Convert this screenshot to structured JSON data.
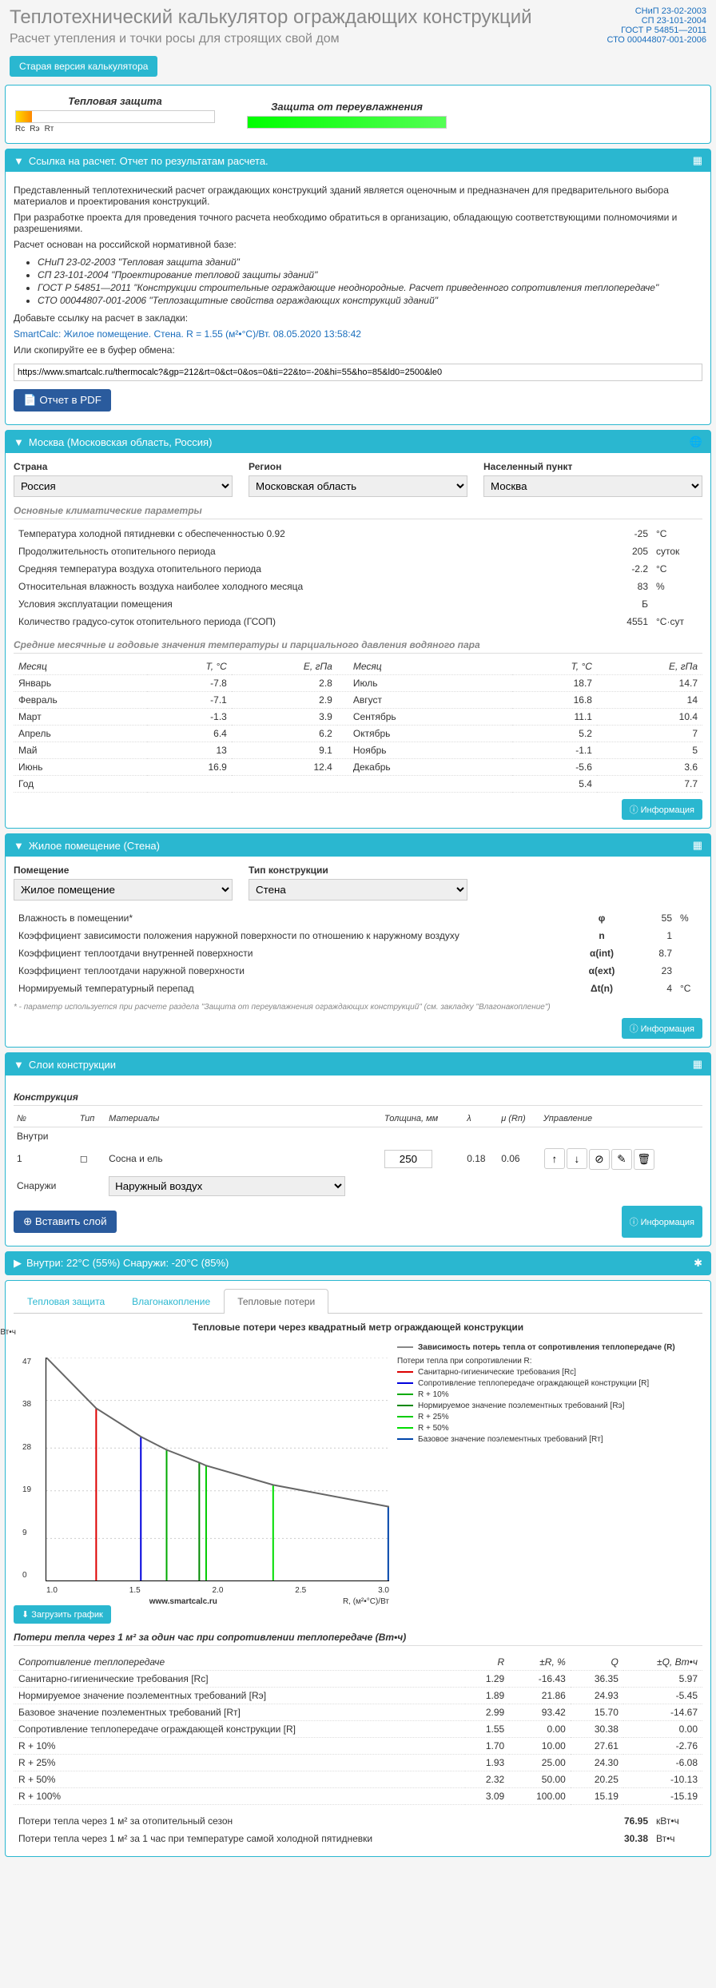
{
  "header": {
    "title": "Теплотехнический калькулятор ограждающих конструкций",
    "subtitle": "Расчет утепления и точки росы для строящих свой дом",
    "norms": [
      "СНиП 23-02-2003",
      "СП 23-101-2004",
      "ГОСТ Р 54851—2011",
      "СТО 00044807-001-2006"
    ],
    "old_version_btn": "Старая версия калькулятора"
  },
  "indicators": {
    "thermal_label": "Тепловая защита",
    "moisture_label": "Защита от переувлажнения",
    "marks": [
      "Rс",
      "Rэ",
      "Rт"
    ]
  },
  "report_panel": {
    "title": "Ссылка на расчет. Отчет по результатам расчета.",
    "p1": "Представленный теплотехнический расчет ограждающих конструкций зданий является оценочным и предназначен для предварительного выбора материалов и проектирования конструкций.",
    "p2": "При разработке проекта для проведения точного расчета необходимо обратиться в организацию, обладающую соответствующими полномочиями и разрешениями.",
    "p3": "Расчет основан на российской нормативной базе:",
    "norms": [
      "СНиП 23-02-2003 \"Тепловая защита зданий\"",
      "СП 23-101-2004 \"Проектирование тепловой защиты зданий\"",
      "ГОСТ Р 54851—2011 \"Конструкции строительные ограждающие неоднородные. Расчет приведенного сопротивления теплопередаче\"",
      "СТО 00044807-001-2006 \"Теплозащитные свойства ограждающих конструкций зданий\""
    ],
    "bookmark_text": "Добавьте ссылку на расчет в закладки:",
    "bookmark_link": "SmartCalc: Жилое помещение. Стена. R = 1.55 (м²•°С)/Вт. 08.05.2020 13:58:42",
    "copy_text": "Или скопируйте ее в буфер обмена:",
    "url": "https://www.smartcalc.ru/thermocalc?&gp=212&rt=0&ct=0&os=0&ti=22&to=-20&hi=55&ho=85&ld0=2500&le0",
    "pdf_btn": "Отчет в PDF"
  },
  "location_panel": {
    "title": "Москва (Московская область, Россия)",
    "country_label": "Страна",
    "country_value": "Россия",
    "region_label": "Регион",
    "region_value": "Московская область",
    "city_label": "Населенный пункт",
    "city_value": "Москва",
    "climate_title": "Основные климатические параметры",
    "params": [
      {
        "name": "Температура холодной пятидневки с обеспеченностью 0.92",
        "val": "-25",
        "unit": "°С"
      },
      {
        "name": "Продолжительность отопительного периода",
        "val": "205",
        "unit": "суток"
      },
      {
        "name": "Средняя температура воздуха отопительного периода",
        "val": "-2.2",
        "unit": "°С"
      },
      {
        "name": "Относительная влажность воздуха наиболее холодного месяца",
        "val": "83",
        "unit": "%"
      },
      {
        "name": "Условия эксплуатации помещения",
        "val": "Б",
        "unit": ""
      },
      {
        "name": "Количество градусо-суток отопительного периода (ГСОП)",
        "val": "4551",
        "unit": "°С·сут"
      }
    ],
    "monthly_title": "Средние месячные и годовые значения температуры и парциального давления водяного пара",
    "month_hdr": "Месяц",
    "t_hdr": "T, °С",
    "e_hdr": "E, гПа",
    "months_left": [
      [
        "Январь",
        "-7.8",
        "2.8"
      ],
      [
        "Февраль",
        "-7.1",
        "2.9"
      ],
      [
        "Март",
        "-1.3",
        "3.9"
      ],
      [
        "Апрель",
        "6.4",
        "6.2"
      ],
      [
        "Май",
        "13",
        "9.1"
      ],
      [
        "Июнь",
        "16.9",
        "12.4"
      ]
    ],
    "months_right": [
      [
        "Июль",
        "18.7",
        "14.7"
      ],
      [
        "Август",
        "16.8",
        "14"
      ],
      [
        "Сентябрь",
        "11.1",
        "10.4"
      ],
      [
        "Октябрь",
        "5.2",
        "7"
      ],
      [
        "Ноябрь",
        "-1.1",
        "5"
      ],
      [
        "Декабрь",
        "-5.6",
        "3.6"
      ]
    ],
    "year_label": "Год",
    "year_t": "5.4",
    "year_e": "7.7",
    "info_btn": "Информация"
  },
  "room_panel": {
    "title": "Жилое помещение (Стена)",
    "room_label": "Помещение",
    "room_value": "Жилое помещение",
    "type_label": "Тип конструкции",
    "type_value": "Стена",
    "params": [
      {
        "name": "Влажность в помещении*",
        "sym": "φ",
        "val": "55",
        "unit": "%"
      },
      {
        "name": "Коэффициент зависимости положения наружной поверхности по отношению к наружному воздуху",
        "sym": "n",
        "val": "1",
        "unit": ""
      },
      {
        "name": "Коэффициент теплоотдачи внутренней поверхности",
        "sym": "α(int)",
        "val": "8.7",
        "unit": ""
      },
      {
        "name": "Коэффициент теплоотдачи наружной поверхности",
        "sym": "α(ext)",
        "val": "23",
        "unit": ""
      },
      {
        "name": "Нормируемый температурный перепад",
        "sym": "Δt(n)",
        "val": "4",
        "unit": "°С"
      }
    ],
    "footnote": "* - параметр используется при расчете раздела \"Защита от переувлажнения ограждающих конструкций\" (см. закладку \"Влагонакопление\")"
  },
  "layers_panel": {
    "title": "Слои конструкции",
    "construction_label": "Конструкция",
    "hdr": [
      "№",
      "Тип",
      "Материалы",
      "Толщина, мм",
      "λ",
      "μ (Rп)",
      "Управление"
    ],
    "inside_label": "Внутри",
    "outside_label": "Снаружи",
    "row": {
      "num": "1",
      "material": "Сосна и ель",
      "thickness": "250",
      "lambda": "0.18",
      "mu": "0.06"
    },
    "outside_value": "Наружный воздух",
    "insert_btn": "Вставить слой"
  },
  "conditions_panel": {
    "title": "Внутри: 22°С (55%) Снаружи: -20°С (85%)"
  },
  "heatloss_panel": {
    "tabs": [
      "Тепловая защита",
      "Влагонакопление",
      "Тепловые потери"
    ],
    "chart_title": "Тепловые потери через квадратный метр ограждающей конструкции",
    "y_label": "Q, Вт•ч",
    "x_label": "R, (м²•°С)/Вт",
    "legend_main": "Зависимость потерь тепла от сопротивления теплопередаче (R)",
    "legend_sub": "Потери тепла при сопротивлении R:",
    "legend": [
      {
        "c": "#d00",
        "t": "Санитарно-гигиенические требования [Rс]"
      },
      {
        "c": "#00d",
        "t": "Сопротивление теплопередаче ограждающей конструкции [R]"
      },
      {
        "c": "#0a0",
        "t": "R + 10%"
      },
      {
        "c": "#080",
        "t": "Нормируемое значение поэлементных требований [Rэ]"
      },
      {
        "c": "#0c0",
        "t": "R + 25%"
      },
      {
        "c": "#0d0",
        "t": "R + 50%"
      },
      {
        "c": "#04a",
        "t": "Базовое значение поэлементных требований [Rт]"
      }
    ],
    "watermark": "www.smartcalc.ru",
    "download_btn": "Загрузить график",
    "results_title": "Потери тепла через 1 м² за один час при сопротивлении теплопередаче (Вт•ч)",
    "results_hdr": [
      "Сопротивление теплопередаче",
      "R",
      "±R, %",
      "Q",
      "±Q, Вт•ч"
    ],
    "results": [
      [
        "Санитарно-гигиенические требования [Rс]",
        "1.29",
        "-16.43",
        "36.35",
        "5.97"
      ],
      [
        "Нормируемое значение поэлементных требований [Rэ]",
        "1.89",
        "21.86",
        "24.93",
        "-5.45"
      ],
      [
        "Базовое значение поэлементных требований [Rт]",
        "2.99",
        "93.42",
        "15.70",
        "-14.67"
      ],
      [
        "Сопротивление теплопередаче ограждающей конструкции [R]",
        "1.55",
        "0.00",
        "30.38",
        "0.00"
      ],
      [
        "R + 10%",
        "1.70",
        "10.00",
        "27.61",
        "-2.76"
      ],
      [
        "R + 25%",
        "1.93",
        "25.00",
        "24.30",
        "-6.08"
      ],
      [
        "R + 50%",
        "2.32",
        "50.00",
        "20.25",
        "-10.13"
      ],
      [
        "R + 100%",
        "3.09",
        "100.00",
        "15.19",
        "-15.19"
      ]
    ],
    "season_label": "Потери тепла через 1 м² за отопительный сезон",
    "season_val": "76.95",
    "season_unit": "кВт•ч",
    "cold_label": "Потери тепла через 1 м² за 1 час при температуре самой холодной пятидневки",
    "cold_val": "30.38",
    "cold_unit": "Вт•ч"
  },
  "chart_data": {
    "type": "line",
    "x": [
      1.0,
      1.29,
      1.55,
      1.7,
      1.89,
      1.93,
      2.32,
      2.99,
      3.0
    ],
    "y": [
      47,
      36.35,
      30.38,
      27.61,
      24.93,
      24.3,
      20.25,
      15.7,
      15.6
    ],
    "xlim": [
      1.0,
      3.0
    ],
    "ylim": [
      0,
      47
    ],
    "xticks": [
      1.0,
      1.5,
      2.0,
      2.5,
      3.0
    ],
    "yticks": [
      0,
      9,
      19,
      28,
      38,
      47
    ],
    "verticals": [
      {
        "x": 1.29,
        "c": "#d00"
      },
      {
        "x": 1.55,
        "c": "#00d"
      },
      {
        "x": 1.7,
        "c": "#0a0"
      },
      {
        "x": 1.89,
        "c": "#080"
      },
      {
        "x": 1.93,
        "c": "#0c0"
      },
      {
        "x": 2.32,
        "c": "#0d0"
      },
      {
        "x": 2.99,
        "c": "#04a"
      }
    ]
  }
}
